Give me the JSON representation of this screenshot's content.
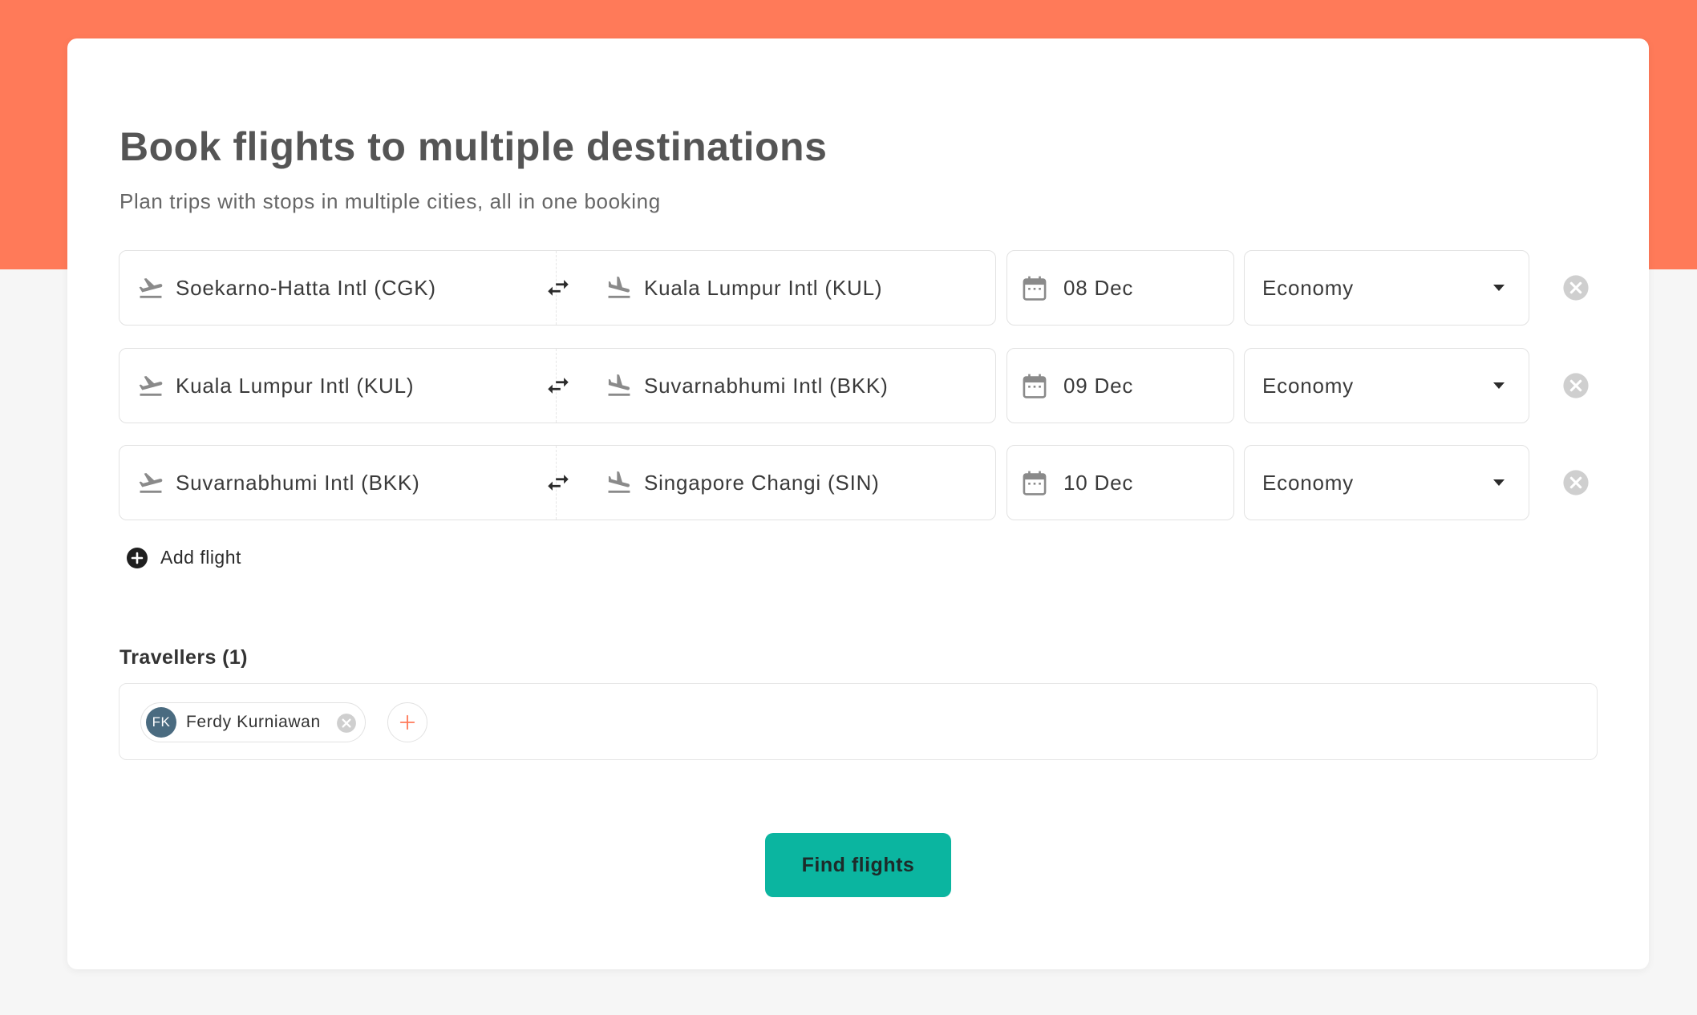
{
  "header": {
    "title": "Book flights to multiple destinations",
    "subtitle": "Plan trips with stops in multiple cities, all in one booking"
  },
  "flights": [
    {
      "from": "Soekarno-Hatta Intl (CGK)",
      "to": "Kuala Lumpur Intl (KUL)",
      "date": "08 Dec",
      "cabin_class": "Economy"
    },
    {
      "from": "Kuala Lumpur Intl (KUL)",
      "to": "Suvarnabhumi Intl (BKK)",
      "date": "09 Dec",
      "cabin_class": "Economy"
    },
    {
      "from": "Suvarnabhumi Intl (BKK)",
      "to": "Singapore Changi (SIN)",
      "date": "10 Dec",
      "cabin_class": "Economy"
    }
  ],
  "add_flight_label": "Add flight",
  "travellers": {
    "title": "Travellers (1)",
    "list": [
      {
        "initials": "FK",
        "name": "Ferdy Kurniawan"
      }
    ]
  },
  "find_button_label": "Find flights",
  "colors": {
    "header_band": "#ff7a59",
    "primary_button": "#0bb5a0",
    "avatar": "#4a6b80",
    "add_traveller_accent": "#ff7a59"
  },
  "icons": {
    "departure": "plane-takeoff-icon",
    "arrival": "plane-landing-icon",
    "swap": "swap-arrows-icon",
    "date": "calendar-icon",
    "dropdown": "caret-down-icon",
    "remove": "close-circle-icon",
    "add": "plus-circle-icon"
  }
}
